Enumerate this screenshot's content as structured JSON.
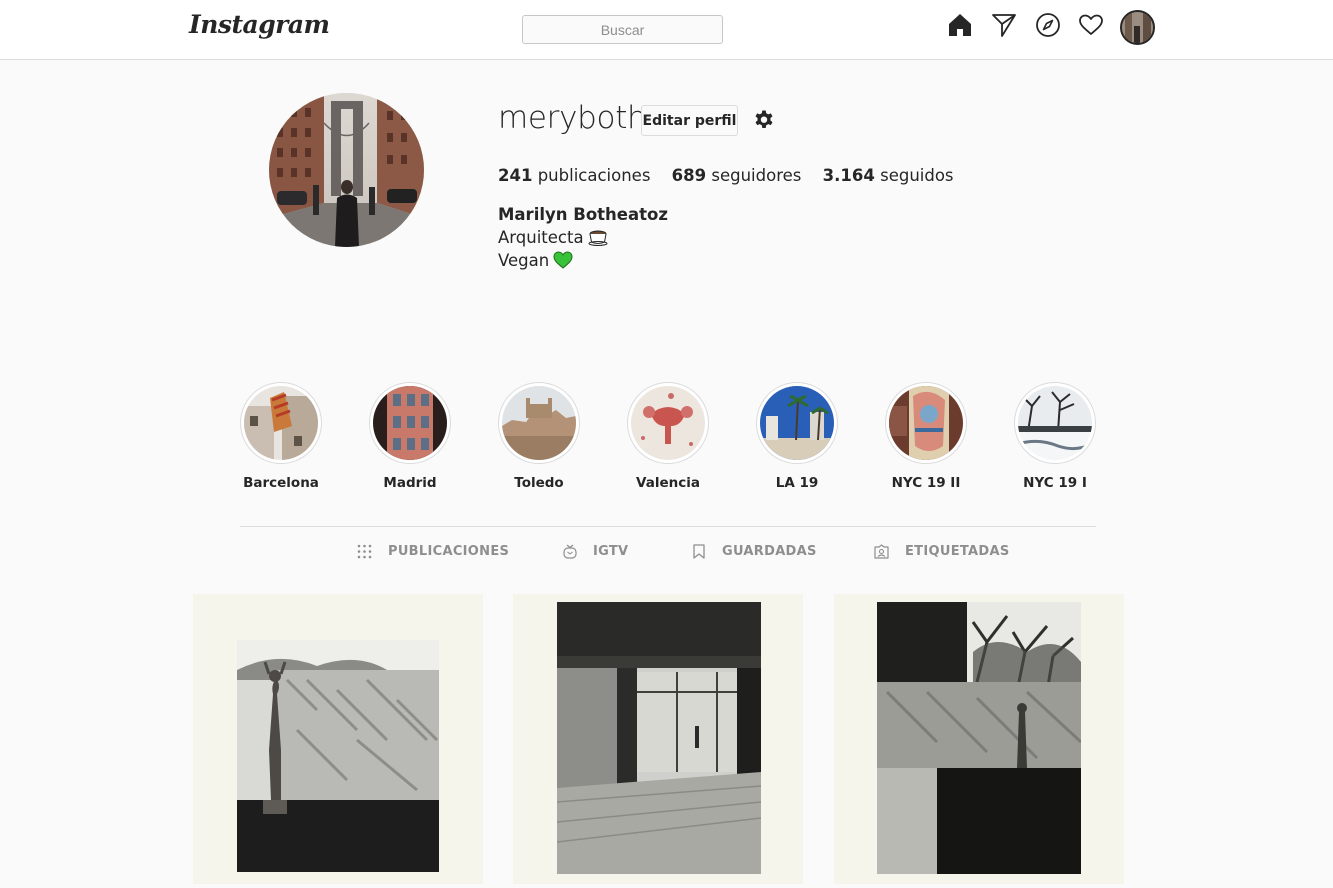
{
  "header": {
    "logo": "Instagram",
    "search_placeholder": "Buscar",
    "nav_icons": [
      "home-icon",
      "direct-icon",
      "explore-icon",
      "activity-icon",
      "profile-avatar"
    ]
  },
  "profile": {
    "username": "meryboth",
    "edit_label": "Editar perfil",
    "stats": [
      {
        "count": "241",
        "label": "publicaciones"
      },
      {
        "count": "689",
        "label": "seguidores"
      },
      {
        "count": "3.164",
        "label": "seguidos"
      }
    ],
    "full_name": "Marilyn Botheatoz",
    "bio": [
      {
        "text": "Arquitecta",
        "icon": "coffee-icon"
      },
      {
        "text": "Vegan",
        "icon": "green-heart-icon"
      }
    ]
  },
  "highlights": [
    {
      "label": "Barcelona"
    },
    {
      "label": "Madrid"
    },
    {
      "label": "Toledo"
    },
    {
      "label": "Valencia"
    },
    {
      "label": "LA 19"
    },
    {
      "label": "NYC 19 II"
    },
    {
      "label": "NYC 19 I"
    }
  ],
  "tabs": [
    {
      "label": "PUBLICACIONES",
      "icon": "grid-icon"
    },
    {
      "label": "IGTV",
      "icon": "igtv-icon"
    },
    {
      "label": "GUARDADAS",
      "icon": "bookmark-icon"
    },
    {
      "label": "ETIQUETADAS",
      "icon": "tagged-icon"
    }
  ],
  "colors": {
    "text": "#262626",
    "muted": "#8e8e8e",
    "border": "#dbdbdb",
    "background": "#fafafa",
    "heart_green": "#3ac13a"
  }
}
